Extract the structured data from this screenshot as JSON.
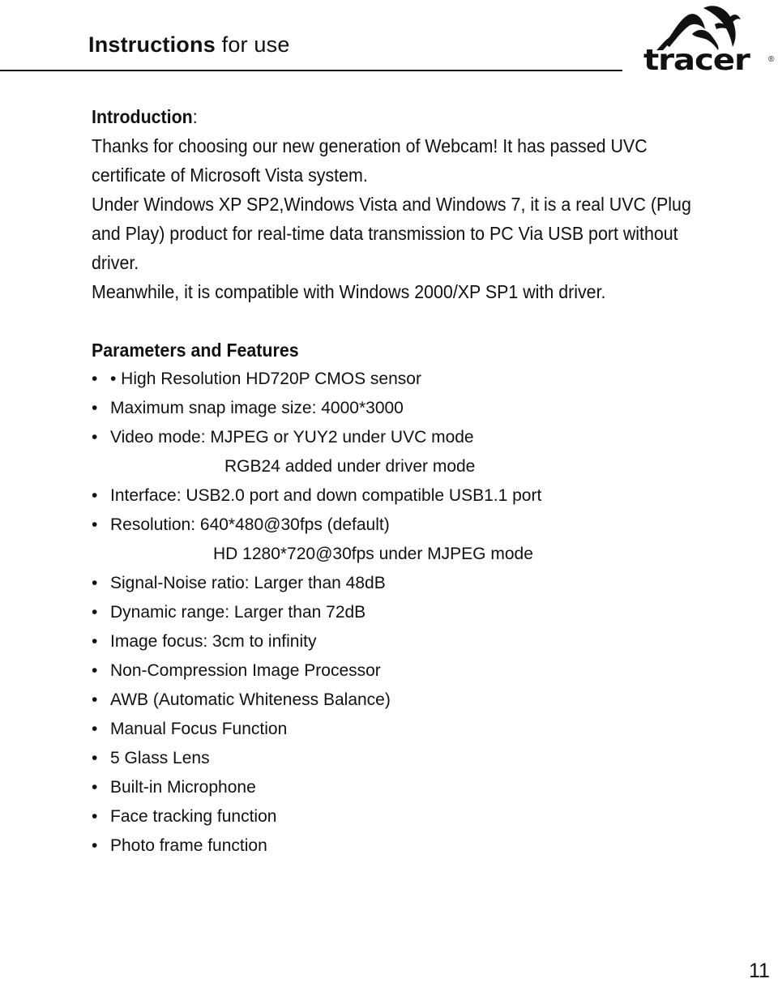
{
  "header": {
    "title_strong": "Instructions",
    "title_light": " for use",
    "brand": {
      "icon": "tracer-logo-icon",
      "wordmark": "tracer",
      "registered": "®"
    }
  },
  "introduction": {
    "heading": "Introduction",
    "heading_suffix": ":",
    "lines": [
      "Thanks for choosing our new generation of Webcam! It has passed UVC",
      "certificate of Microsoft Vista system.",
      "Under Windows XP SP2,Windows Vista and Windows 7, it is a real UVC (Plug",
      "and Play) product for real-time data transmission to PC Via USB port without",
      "driver.",
      "Meanwhile, it is compatible with Windows 2000/XP SP1 with driver."
    ]
  },
  "features": {
    "heading": "Parameters and Features",
    "bullet_glyph": "•",
    "items": [
      "• High Resolution HD720P CMOS sensor",
      "Maximum snap image size: 4000*3000",
      "Video mode: MJPEG or YUY2 under UVC mode",
      "Interface: USB2.0 port and down compatible USB1.1 port",
      "Resolution: 640*480@30fps (default)",
      "Signal-Noise ratio: Larger than 48dB",
      "Dynamic range: Larger than 72dB",
      "Image focus: 3cm to infinity",
      "Non-Compression Image Processor",
      "AWB (Automatic Whiteness Balance)",
      "Manual Focus Function",
      "5 Glass Lens",
      "Built-in Microphone",
      "Face tracking function",
      "Photo frame function"
    ],
    "video_mode_continuation": "RGB24 added under driver mode",
    "resolution_continuation": "HD 1280*720@30fps under MJPEG mode"
  },
  "footer": {
    "page_number": "11"
  }
}
